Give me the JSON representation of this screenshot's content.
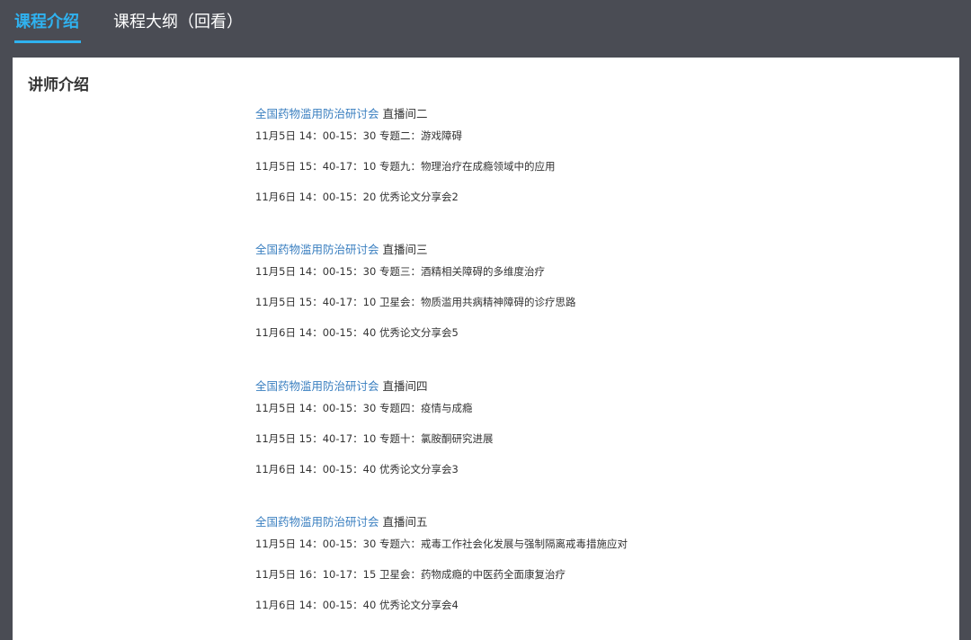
{
  "tabs": [
    {
      "label": "课程介绍",
      "active": true
    },
    {
      "label": "课程大纲（回看）",
      "active": false
    }
  ],
  "colors": {
    "topbar_bg": "#4a4c54",
    "active_tab": "#2fb2f0",
    "link": "#3a7fc0",
    "text": "#333333"
  },
  "section_title": "讲师介绍",
  "rooms": [
    {
      "link": "全国药物滥用防治研讨会",
      "room": "直播间二",
      "sessions": [
        "11月5日 14：00-15：30 专题二：游戏障碍",
        "11月5日 15：40-17：10 专题九：物理治疗在成瘾领域中的应用",
        "11月6日 14：00-15：20 优秀论文分享会2"
      ]
    },
    {
      "link": "全国药物滥用防治研讨会",
      "room": "直播间三",
      "sessions": [
        "11月5日 14：00-15：30 专题三：酒精相关障碍的多维度治疗",
        "11月5日 15：40-17：10 卫星会：物质滥用共病精神障碍的诊疗思路",
        "11月6日 14：00-15：40 优秀论文分享会5"
      ]
    },
    {
      "link": "全国药物滥用防治研讨会",
      "room": "直播间四",
      "sessions": [
        "11月5日 14：00-15：30 专题四：疫情与成瘾",
        "11月5日 15：40-17：10 专题十：氯胺酮研究进展",
        "11月6日 14：00-15：40 优秀论文分享会3"
      ]
    },
    {
      "link": "全国药物滥用防治研讨会",
      "room": "直播间五",
      "sessions": [
        "11月5日 14：00-15：30 专题六：戒毒工作社会化发展与强制隔离戒毒措施应对",
        "11月5日 16：10-17：15 卫星会：药物成瘾的中医药全面康复治疗",
        "11月6日 14：00-15：40 优秀论文分享会4"
      ]
    }
  ]
}
